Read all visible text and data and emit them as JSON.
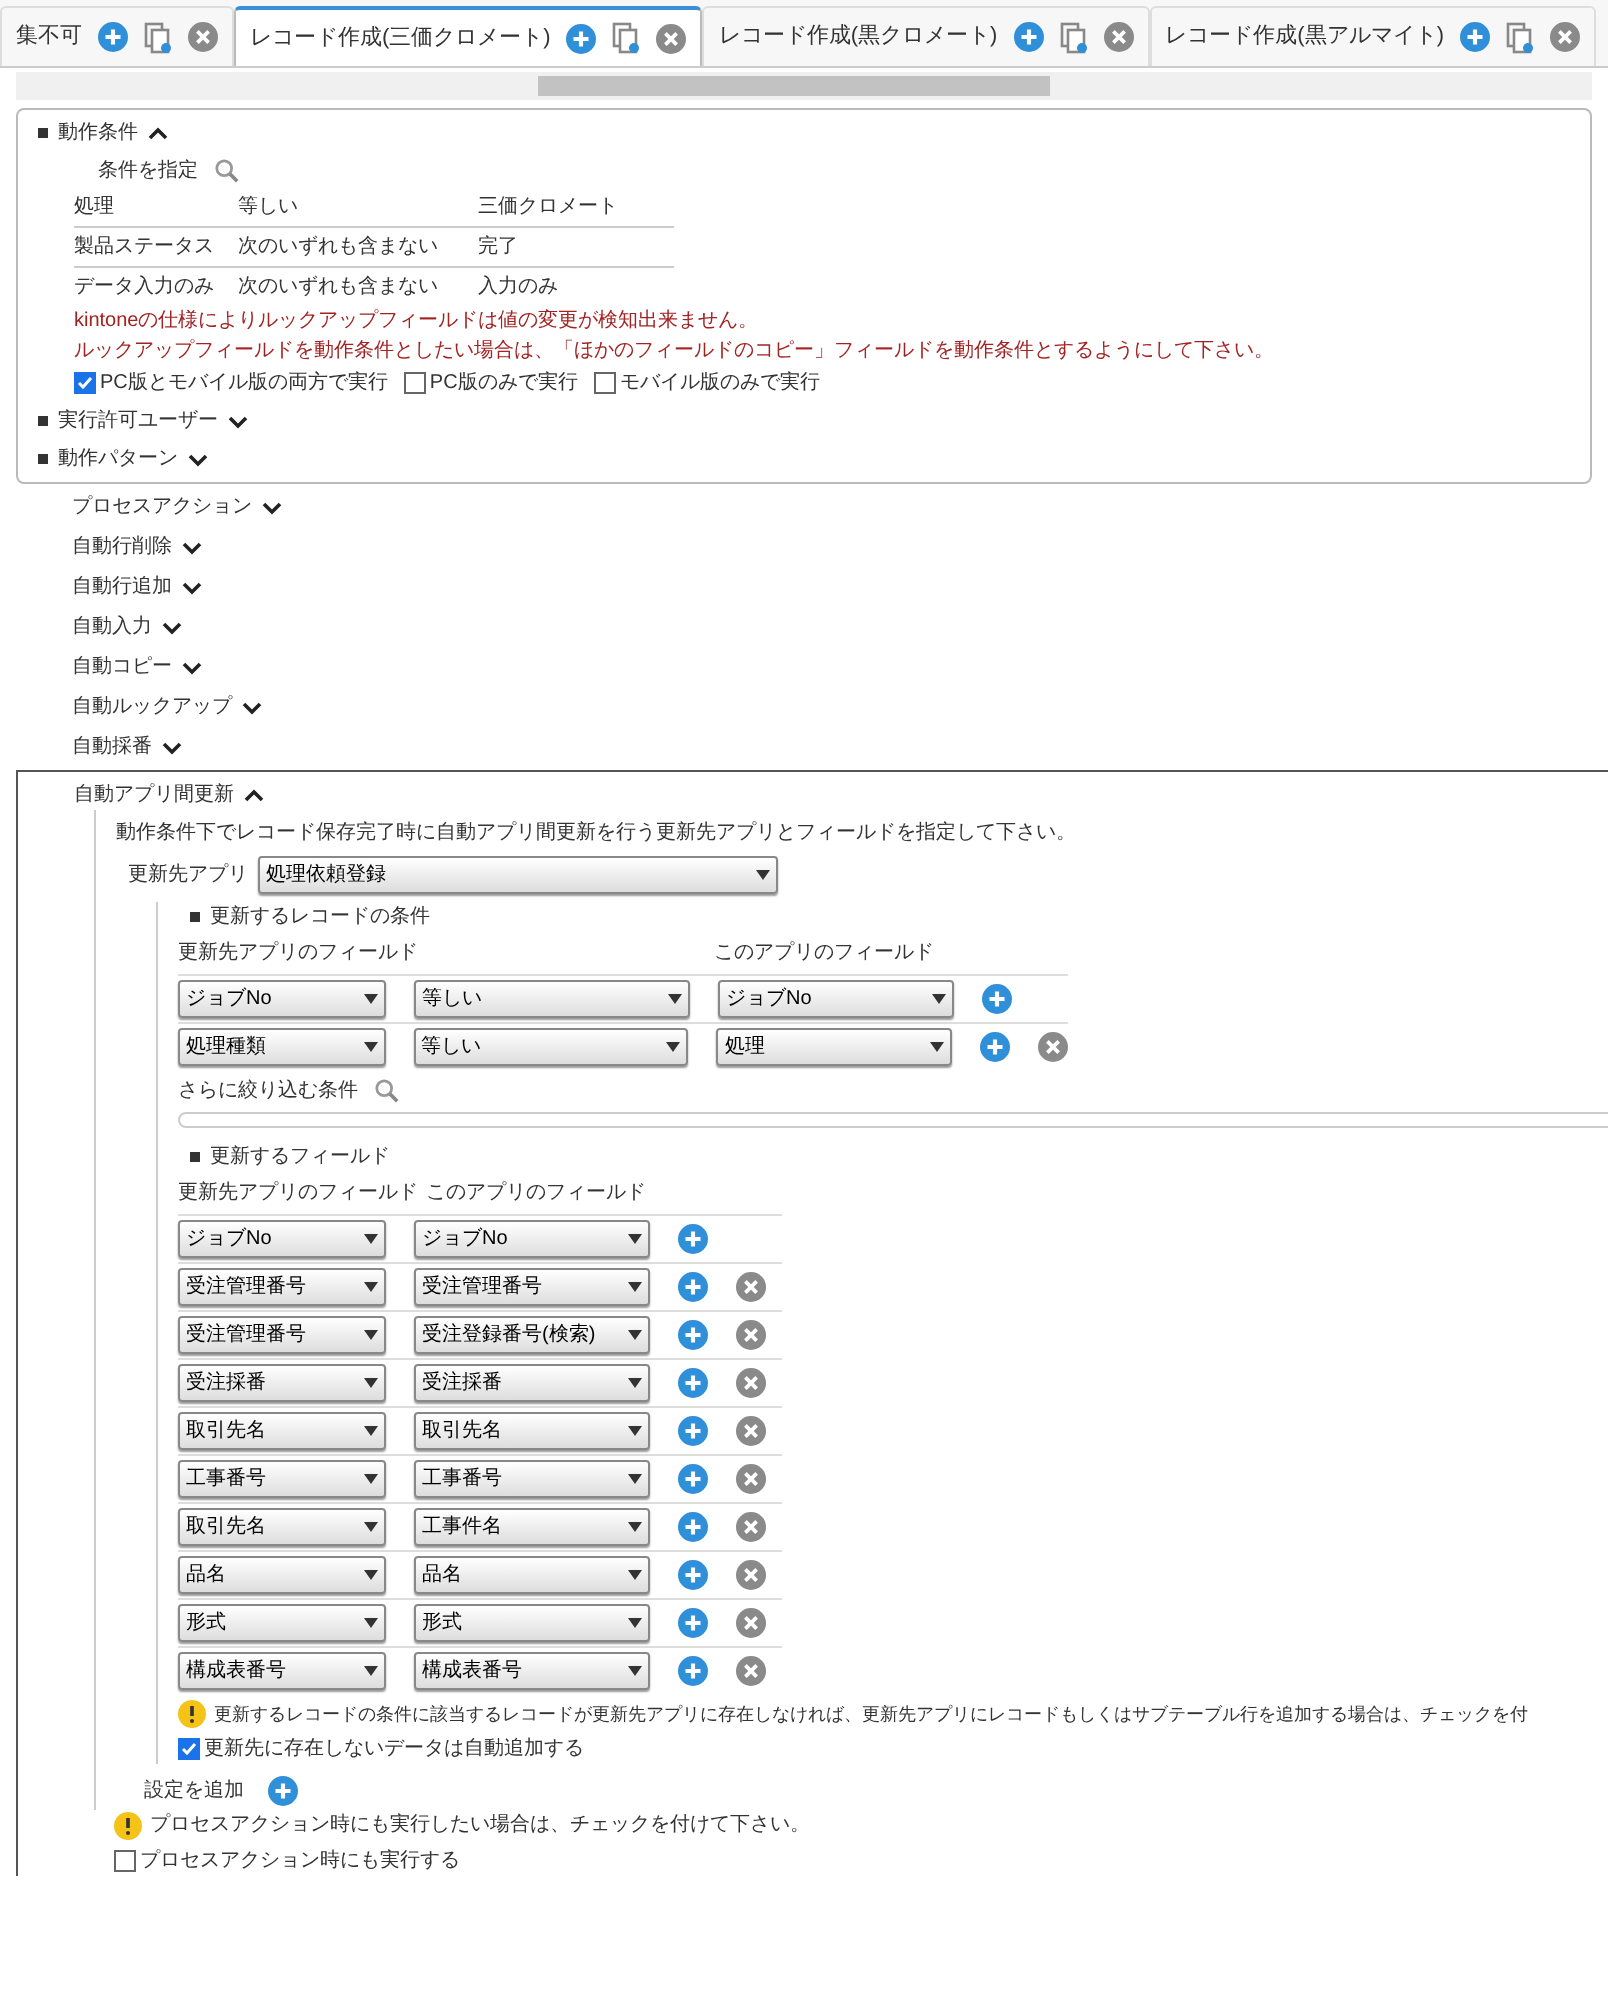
{
  "tabs": [
    {
      "label": "集不可",
      "selected": false
    },
    {
      "label": "レコード作成(三価クロメート)",
      "selected": true
    },
    {
      "label": "レコード作成(黒クロメート)",
      "selected": false
    },
    {
      "label": "レコード作成(黒アルマイト)",
      "selected": false
    }
  ],
  "condition_section": {
    "title": "動作条件",
    "expanded": true,
    "search_label": "条件を指定",
    "rows": [
      [
        "処理",
        "等しい",
        "三価クロメート"
      ],
      [
        "製品ステータス",
        "次のいずれも含まない",
        "完了"
      ],
      [
        "データ入力のみ",
        "次のいずれも含まない",
        "入力のみ"
      ]
    ],
    "warnings": [
      "kintoneの仕様によりルックアップフィールドは値の変更が検知出来ません。",
      "ルックアップフィールドを動作条件としたい場合は、「ほかのフィールドのコピー」フィールドを動作条件とするようにして下さい。"
    ],
    "options": [
      {
        "label": "PC版とモバイル版の両方で実行",
        "checked": true
      },
      {
        "label": "PC版のみで実行",
        "checked": false
      },
      {
        "label": "モバイル版のみで実行",
        "checked": false
      }
    ]
  },
  "sections": [
    {
      "title": "実行許可ユーザー",
      "expanded": false
    },
    {
      "title": "動作パターン",
      "expanded": false
    }
  ],
  "actions": [
    {
      "title": "プロセスアクション",
      "expanded": false
    },
    {
      "title": "自動行削除",
      "expanded": false
    },
    {
      "title": "自動行追加",
      "expanded": false
    },
    {
      "title": "自動入力",
      "expanded": false
    },
    {
      "title": "自動コピー",
      "expanded": false
    },
    {
      "title": "自動ルックアップ",
      "expanded": false
    },
    {
      "title": "自動採番",
      "expanded": false
    }
  ],
  "app_update": {
    "title": "自動アプリ間更新",
    "expanded": true,
    "description": "動作条件下でレコード保存完了時に自動アプリ間更新を行う更新先アプリとフィールドを指定して下さい。",
    "target_label": "更新先アプリ",
    "target_value": "処理依頼登録",
    "record_conditions": {
      "title": "更新するレコードの条件",
      "headers": [
        "更新先アプリのフィールド",
        "このアプリのフィールド"
      ],
      "rows": [
        {
          "field": "ジョブNo",
          "operator": "等しい",
          "this_field": "ジョブNo",
          "removable": false
        },
        {
          "field": "処理種類",
          "operator": "等しい",
          "this_field": "処理",
          "removable": true
        }
      ],
      "refine_label": "さらに絞り込む条件"
    },
    "update_fields": {
      "title": "更新するフィールド",
      "headers": [
        "更新先アプリのフィールド",
        "このアプリのフィールド"
      ],
      "rows": [
        {
          "field": "ジョブNo",
          "this_field": "ジョブNo",
          "removable": false
        },
        {
          "field": "受注管理番号",
          "this_field": "受注管理番号",
          "removable": true
        },
        {
          "field": "受注管理番号",
          "this_field": "受注登録番号(検索)",
          "removable": true
        },
        {
          "field": "受注採番",
          "this_field": "受注採番",
          "removable": true
        },
        {
          "field": "取引先名",
          "this_field": "取引先名",
          "removable": true
        },
        {
          "field": "工事番号",
          "this_field": "工事番号",
          "removable": true
        },
        {
          "field": "取引先名",
          "this_field": "工事件名",
          "removable": true
        },
        {
          "field": "品名",
          "this_field": "品名",
          "removable": true
        },
        {
          "field": "形式",
          "this_field": "形式",
          "removable": true
        },
        {
          "field": "構成表番号",
          "this_field": "構成表番号",
          "removable": true
        }
      ]
    },
    "notice": "更新するレコードの条件に該当するレコードが更新先アプリに存在しなければ、更新先アプリにレコードもしくはサブテーブル行を追加する場合は、チェックを付",
    "auto_add": {
      "label": "更新先に存在しないデータは自動追加する",
      "checked": true
    },
    "add_setting": "設定を追加"
  },
  "process_notice": "プロセスアクション時にも実行したい場合は、チェックを付けて下さい。",
  "process_option": {
    "label": "プロセスアクション時にも実行する",
    "checked": false
  }
}
